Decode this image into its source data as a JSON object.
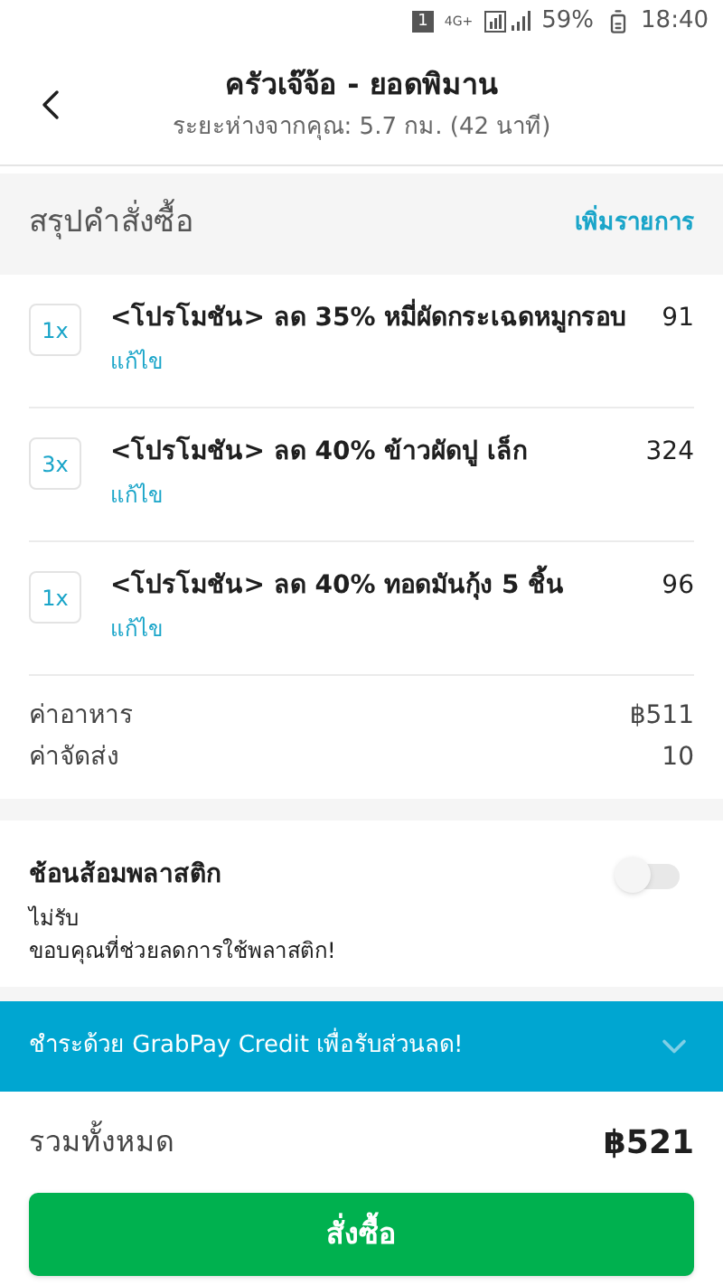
{
  "status_bar": {
    "sim": "1",
    "network": "4G+",
    "battery": "59%",
    "time": "18:40"
  },
  "header": {
    "title": "ครัวเจ๊จ้อ - ยอดพิมาน",
    "subtitle": "ระยะห่างจากคุณ: 5.7 กม. (42 นาที)"
  },
  "summary": {
    "title": "สรุปคำสั่งซื้อ",
    "add_link": "เพิ่มรายการ"
  },
  "items": [
    {
      "qty": "1x",
      "name": "<โปรโมชัน> ลด 35% หมี่ผัดกระเฉดหมูกรอบ",
      "price": "91",
      "edit": "แก้ไข"
    },
    {
      "qty": "3x",
      "name": "<โปรโมชัน> ลด 40% ข้าวผัดปู เล็ก",
      "price": "324",
      "edit": "แก้ไข"
    },
    {
      "qty": "1x",
      "name": "<โปรโมชัน> ลด 40% ทอดมันกุ้ง 5 ชิ้น",
      "price": "96",
      "edit": "แก้ไข"
    }
  ],
  "fees": [
    {
      "label": "ค่าอาหาร",
      "value": "฿511"
    },
    {
      "label": "ค่าจัดส่ง",
      "value": "10"
    }
  ],
  "cutlery": {
    "title": "ช้อนส้อมพลาสติก",
    "status": "ไม่รับ",
    "note": "ขอบคุณที่ช่วยลดการใช้พลาสติก!",
    "on": false
  },
  "promo_banner": {
    "text": "ชำระด้วย GrabPay Credit เพื่อรับส่วนลด!",
    "expanded": false
  },
  "total": {
    "label": "รวมทั้งหมด",
    "value": "฿521"
  },
  "order_button": "สั่งซื้อ"
}
